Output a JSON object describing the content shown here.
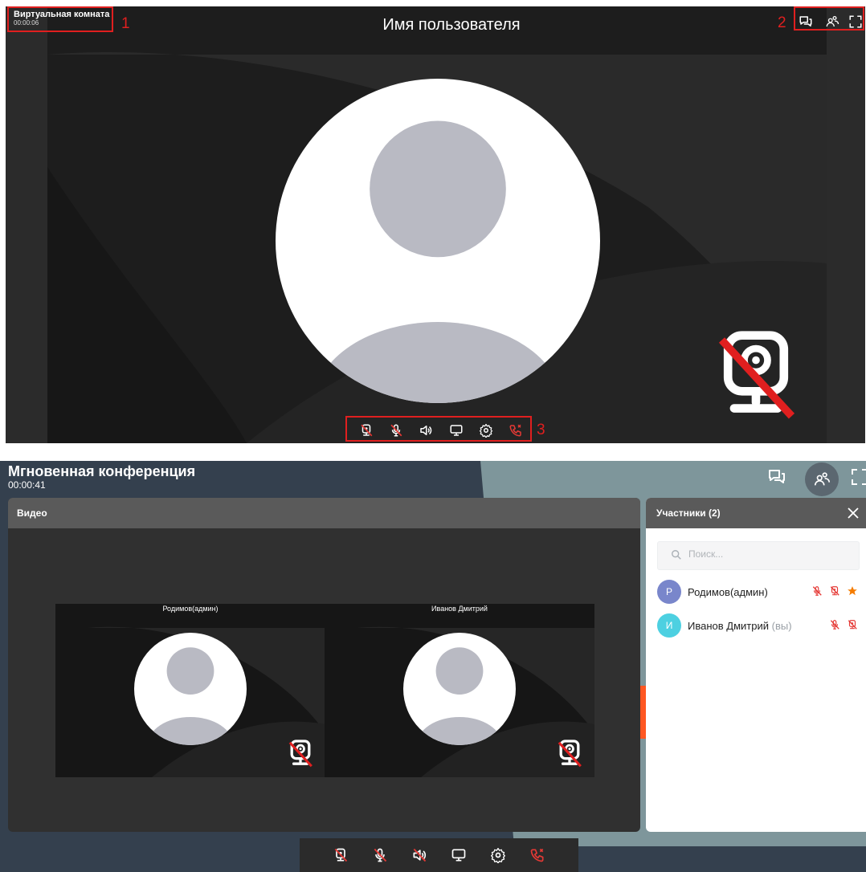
{
  "top_screenshot": {
    "room_title": "Виртуальная комната",
    "timer": "00:00:06",
    "user_name": "Имя пользователя",
    "callouts": [
      "1",
      "2",
      "3"
    ],
    "toolbar_icons": [
      "chat-icon",
      "participants-icon",
      "fullscreen-icon"
    ],
    "controls": [
      "camera-off-icon",
      "microphone-icon",
      "speaker-icon",
      "screen-share-icon",
      "settings-icon",
      "hang-up-icon"
    ],
    "camera_status": "camera-off-icon"
  },
  "bottom_screenshot": {
    "conference_title": "Мгновенная конференция",
    "timer": "00:00:41",
    "video_panel": {
      "title": "Видео",
      "tiles": [
        {
          "name": "Родимов(админ)"
        },
        {
          "name": "Иванов Дмитрий"
        }
      ]
    },
    "participants_panel": {
      "title": "Участники (2)",
      "search_placeholder": "Поиск...",
      "participants": [
        {
          "initial": "Р",
          "name": "Родимов(админ)",
          "suffix": "",
          "avatar_color": "#7986cb",
          "mic_muted": true,
          "camera_off": true,
          "is_admin": true
        },
        {
          "initial": "И",
          "name": "Иванов Дмитрий",
          "suffix": "(вы)",
          "avatar_color": "#4dd0e1",
          "mic_muted": true,
          "camera_off": true,
          "is_admin": false
        }
      ]
    },
    "controls": [
      "camera-off-icon",
      "microphone-muted-icon",
      "speaker-muted-icon",
      "screen-share-icon",
      "settings-icon",
      "hang-up-icon"
    ]
  },
  "colors": {
    "callout_red": "#e01f1f",
    "accent_orange": "#ff5722",
    "star_orange": "#f57c00",
    "muted_red": "#e53935",
    "header_gray": "#5a5a5a"
  }
}
